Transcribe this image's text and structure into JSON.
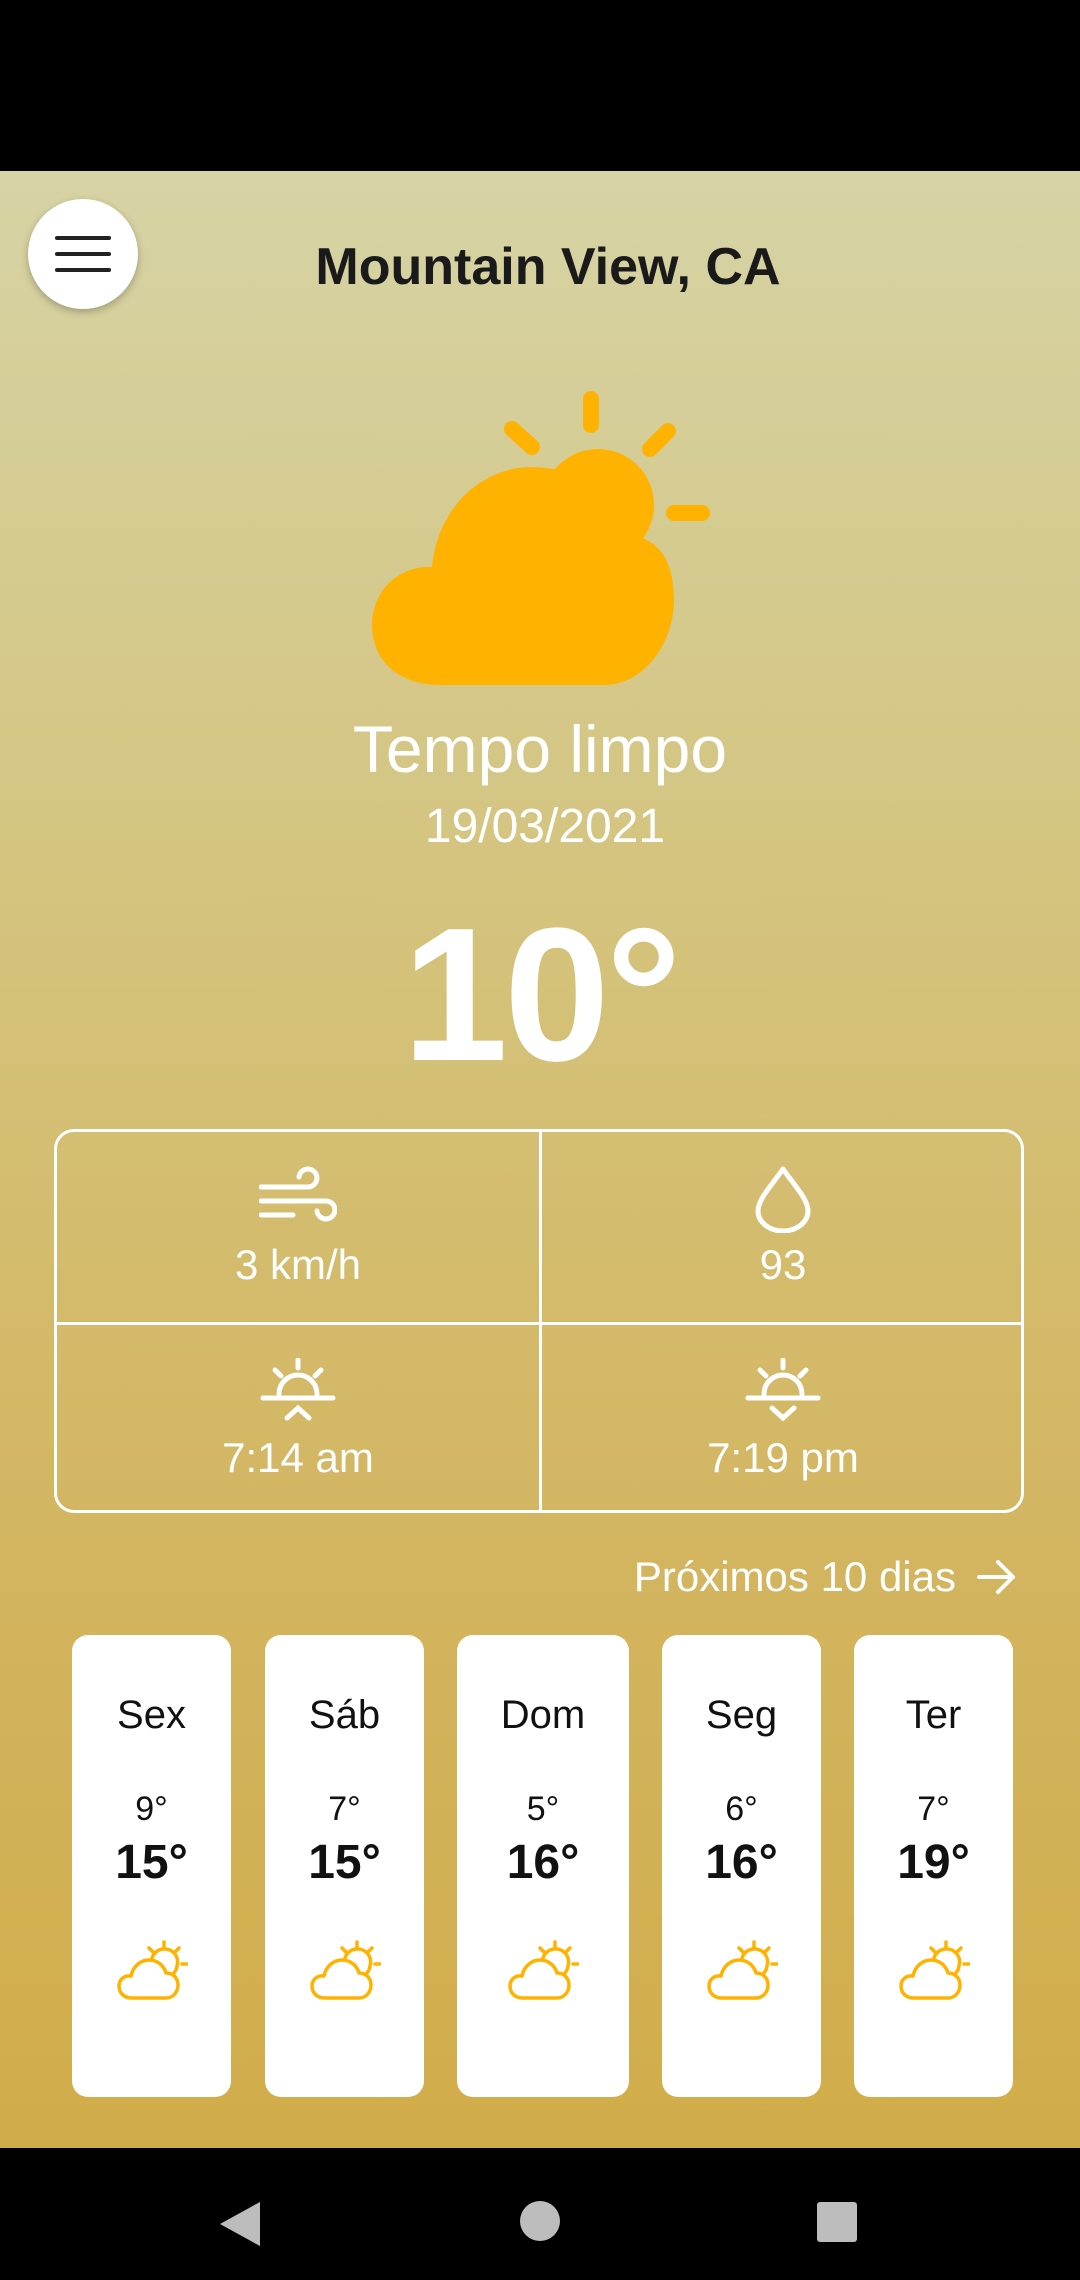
{
  "header": {
    "location": "Mountain View, CA"
  },
  "current": {
    "condition": "Tempo limpo",
    "date": "19/03/2021",
    "temperature": "10°",
    "icon": "partly-cloudy-icon"
  },
  "stats": {
    "wind": {
      "icon": "wind-icon",
      "value": "3 km/h"
    },
    "humidity": {
      "icon": "drop-icon",
      "value": "93"
    },
    "sunrise": {
      "icon": "sunrise-icon",
      "value": "7:14 am"
    },
    "sunset": {
      "icon": "sunset-icon",
      "value": "7:19 pm"
    }
  },
  "forecast": {
    "link_label": "Próximos 10 dias",
    "days": [
      {
        "name": "Sex",
        "low": "9°",
        "high": "15°",
        "icon": "partly-cloudy-icon"
      },
      {
        "name": "Sáb",
        "low": "7°",
        "high": "15°",
        "icon": "partly-cloudy-icon"
      },
      {
        "name": "Dom",
        "low": "5°",
        "high": "16°",
        "icon": "partly-cloudy-icon"
      },
      {
        "name": "Seg",
        "low": "6°",
        "high": "16°",
        "icon": "partly-cloudy-icon"
      },
      {
        "name": "Ter",
        "low": "7°",
        "high": "19°",
        "icon": "partly-cloudy-icon"
      }
    ]
  },
  "colors": {
    "accent": "#FFB300",
    "background_top": "#D6D3A5",
    "background_bottom": "#D1AC4A"
  },
  "nav": {
    "back_icon": "back-triangle-icon",
    "home_icon": "home-circle-icon",
    "recents_icon": "recents-square-icon"
  }
}
